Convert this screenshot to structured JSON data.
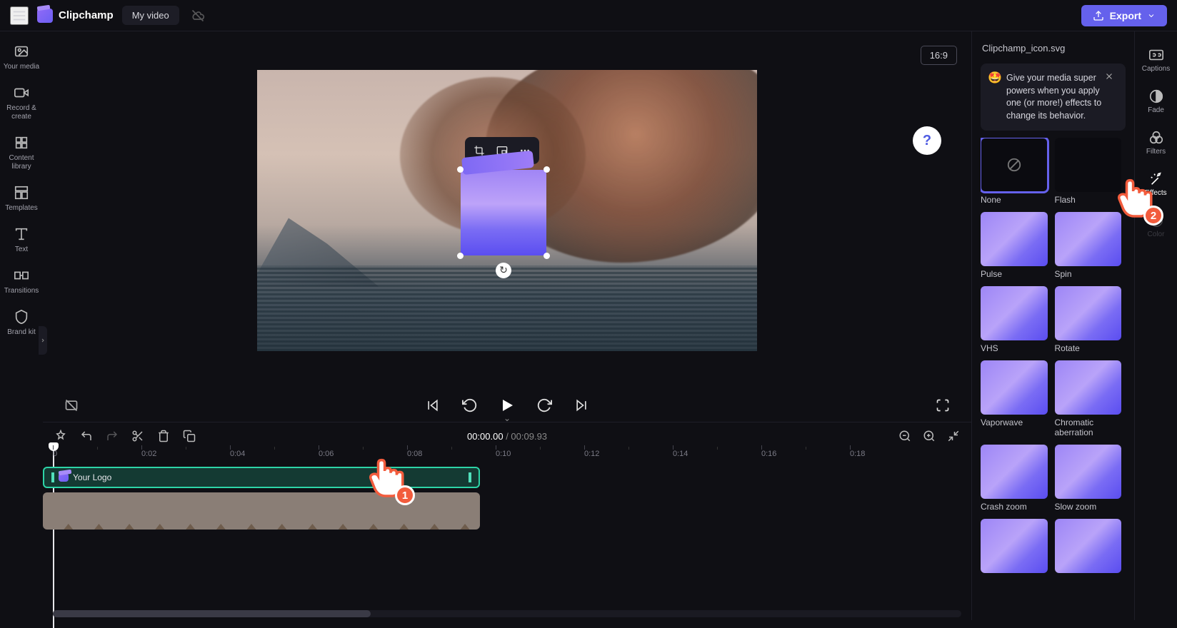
{
  "header": {
    "app_name": "Clipchamp",
    "video_name": "My video",
    "export_label": "Export"
  },
  "left_nav": [
    {
      "label": "Your media",
      "icon": "folder"
    },
    {
      "label": "Record & create",
      "icon": "record"
    },
    {
      "label": "Content library",
      "icon": "library"
    },
    {
      "label": "Templates",
      "icon": "templates"
    },
    {
      "label": "Text",
      "icon": "text"
    },
    {
      "label": "Transitions",
      "icon": "transitions"
    },
    {
      "label": "Brand kit",
      "icon": "brand"
    }
  ],
  "stage": {
    "aspect_ratio": "16:9"
  },
  "timeline": {
    "current_time": "00:00.00",
    "duration": "00:09.93",
    "ticks": [
      "0",
      "0:02",
      "0:04",
      "0:06",
      "0:08",
      "0:10",
      "0:12",
      "0:14",
      "0:16",
      "0:18"
    ],
    "logo_clip_label": "Your Logo"
  },
  "cursors": {
    "cursor1_badge": "1",
    "cursor2_badge": "2"
  },
  "right_panel": {
    "title": "Clipchamp_icon.svg",
    "tip_text": "Give your media super powers when you apply one (or more!) effects to change its behavior.",
    "effects": [
      {
        "name": "None",
        "kind": "none",
        "selected": true
      },
      {
        "name": "Flash",
        "kind": "flash"
      },
      {
        "name": "Pulse"
      },
      {
        "name": "Spin"
      },
      {
        "name": "VHS"
      },
      {
        "name": "Rotate"
      },
      {
        "name": "Vaporwave"
      },
      {
        "name": "Chromatic aberration"
      },
      {
        "name": "Crash zoom"
      },
      {
        "name": "Slow zoom"
      },
      {
        "name": ""
      },
      {
        "name": ""
      }
    ]
  },
  "right_nav": [
    {
      "label": "Captions",
      "icon": "cc"
    },
    {
      "label": "Fade",
      "icon": "fade"
    },
    {
      "label": "Filters",
      "icon": "filters"
    },
    {
      "label": "Effects",
      "icon": "effects",
      "active": true
    },
    {
      "label": "Color",
      "icon": "color"
    }
  ]
}
